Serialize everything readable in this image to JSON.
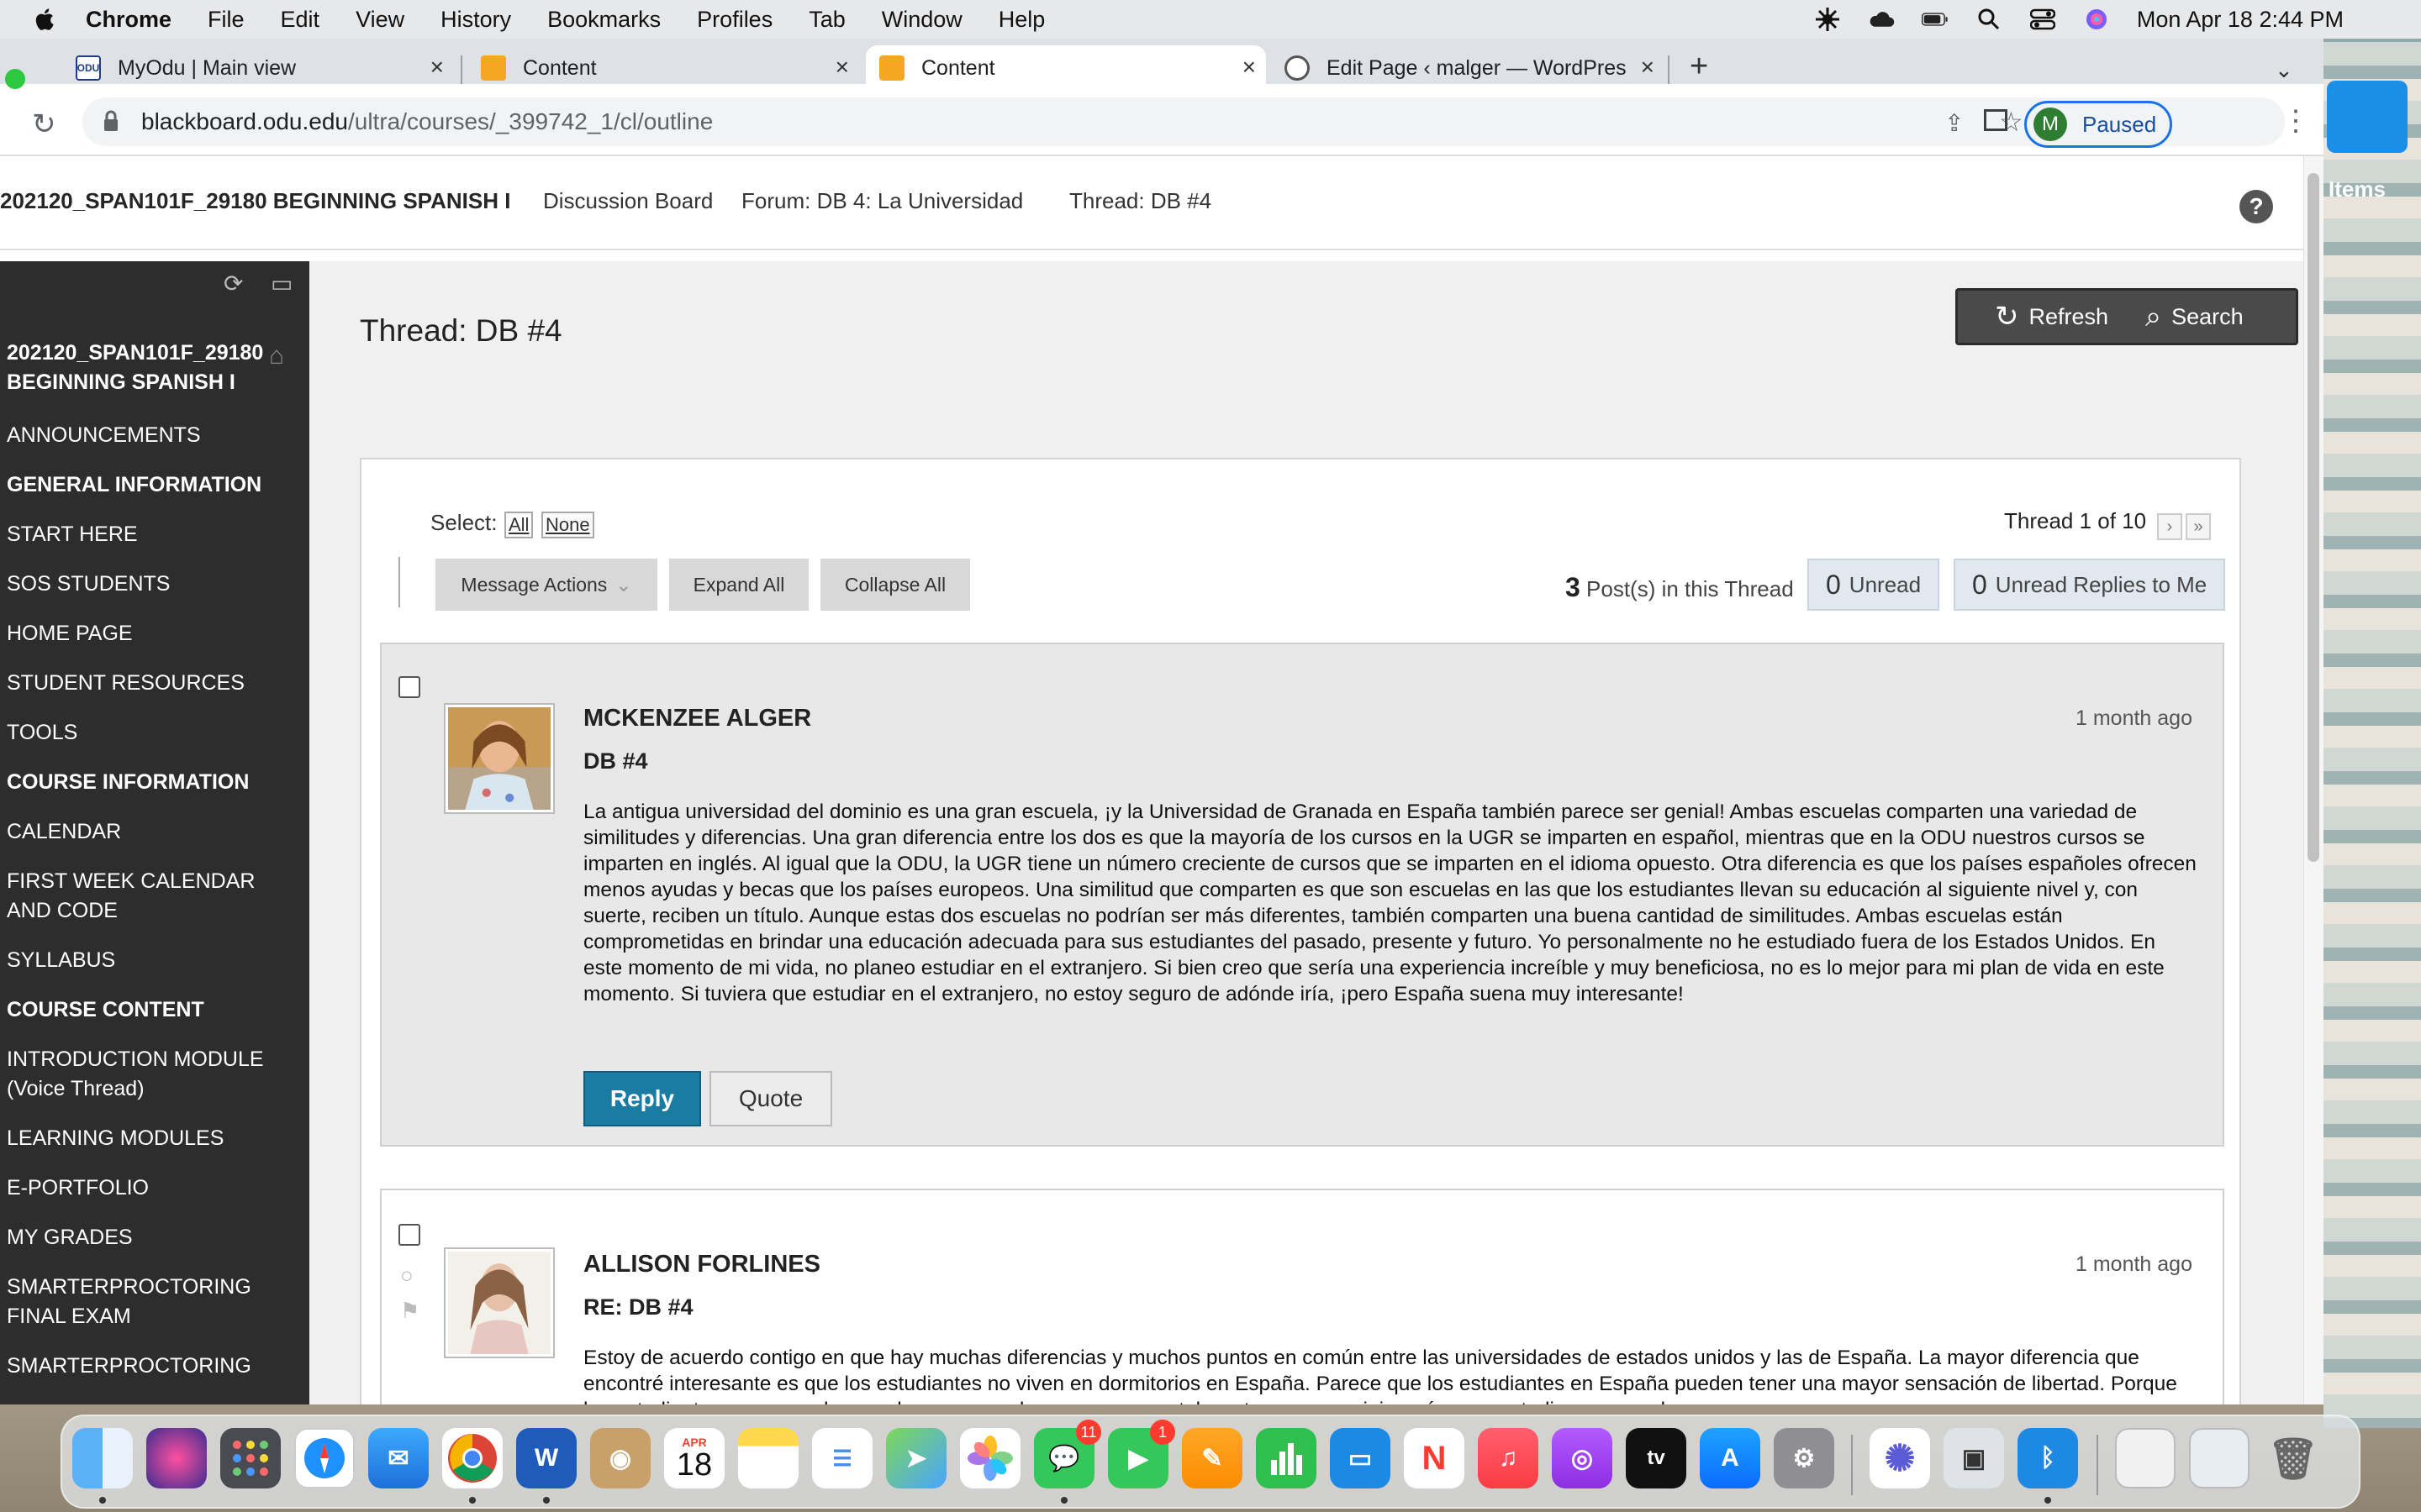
{
  "menubar": {
    "app": "Chrome",
    "items": [
      "File",
      "Edit",
      "View",
      "History",
      "Bookmarks",
      "Profiles",
      "Tab",
      "Window",
      "Help"
    ],
    "clock": "Mon Apr 18  2:44 PM"
  },
  "desktop": {
    "items_label": "Items"
  },
  "tabs": [
    {
      "title": "MyOdu | Main view"
    },
    {
      "title": "Content"
    },
    {
      "title": "Content"
    },
    {
      "title": "Edit Page ‹ malger — WordPres"
    }
  ],
  "address": {
    "host": "blackboard.odu.edu",
    "path": "/ultra/courses/_399742_1/cl/outline"
  },
  "profile": {
    "initial": "M",
    "label": "Paused"
  },
  "breadcrumb": {
    "course": "202120_SPAN101F_29180 BEGINNING SPANISH I",
    "crumbs": [
      "Discussion Board",
      "Forum: DB 4: La Universidad",
      "Thread: DB #4"
    ]
  },
  "sidebar": {
    "course_title": "202120_SPAN101F_29180 BEGINNING SPANISH I",
    "items": [
      {
        "label": "ANNOUNCEMENTS",
        "head": false
      },
      {
        "label": "GENERAL INFORMATION",
        "head": true
      },
      {
        "label": "START HERE",
        "head": false
      },
      {
        "label": "SOS STUDENTS",
        "head": false
      },
      {
        "label": "HOME PAGE",
        "head": false
      },
      {
        "label": "STUDENT RESOURCES",
        "head": false
      },
      {
        "label": "TOOLS",
        "head": false
      },
      {
        "label": "COURSE INFORMATION",
        "head": true
      },
      {
        "label": "CALENDAR",
        "head": false
      },
      {
        "label": "FIRST WEEK CALENDAR AND CODE",
        "head": false
      },
      {
        "label": "SYLLABUS",
        "head": false
      },
      {
        "label": "COURSE CONTENT",
        "head": true
      },
      {
        "label": "INTRODUCTION MODULE (Voice Thread)",
        "head": false
      },
      {
        "label": "LEARNING MODULES",
        "head": false
      },
      {
        "label": "E-PORTFOLIO",
        "head": false
      },
      {
        "label": "MY GRADES",
        "head": false
      },
      {
        "label": "SMARTERPROCTORING FINAL EXAM",
        "head": false
      },
      {
        "label": "SMARTERPROCTORING",
        "head": false
      }
    ]
  },
  "main": {
    "title": "Thread: DB #4",
    "refresh_label": "Refresh",
    "search_label": "Search",
    "select_label": "Select:",
    "select_all": "All",
    "select_none": "None",
    "message_actions": "Message Actions",
    "expand_all": "Expand All",
    "collapse_all": "Collapse All",
    "thread_position": "Thread 1 of 10",
    "post_count": "3",
    "post_count_label": "Post(s) in this Thread",
    "unread_count": "0",
    "unread_label": "Unread",
    "unread_replies_count": "0",
    "unread_replies_label": "Unread Replies to Me"
  },
  "posts": [
    {
      "author": "MCKENZEE ALGER",
      "subject": "DB #4",
      "time": "1 month ago",
      "body": "La antigua universidad del dominio es una gran escuela, ¡y la Universidad de Granada en España también parece ser genial! Ambas escuelas comparten una variedad de similitudes y diferencias. Una gran diferencia entre los dos es que la mayoría de los cursos en la UGR se imparten en español, mientras que en la ODU nuestros cursos se imparten en inglés. Al igual que la ODU, la UGR tiene un número creciente de cursos que se imparten en el idioma opuesto. Otra diferencia es que los países españoles ofrecen menos ayudas y becas que los países europeos. Una similitud que comparten es que son escuelas en las que los estudiantes llevan su educación al siguiente nivel y, con suerte, reciben un título. Aunque estas dos escuelas no podrían ser más diferentes, también comparten una buena cantidad de similitudes. Ambas escuelas están comprometidas en brindar una educación adecuada para sus estudiantes del pasado, presente y futuro. Yo personalmente no he estudiado fuera de los Estados Unidos. En este momento de mi vida, no planeo estudiar en el extranjero. Si bien creo que sería una experiencia increíble y muy beneficiosa, no es lo mejor para mi plan de vida en este momento. Si tuviera que estudiar en el extranjero, no estoy seguro de adónde iría, ¡pero España suena muy interesante!",
      "reply_label": "Reply",
      "quote_label": "Quote"
    },
    {
      "author": "ALLISON FORLINES",
      "subject": "RE: DB #4",
      "time": "1 month ago",
      "body": "Estoy de acuerdo contigo en que hay muchas diferencias y muchos puntos en común entre las universidades de estados unidos y las de España. La mayor diferencia que encontré interesante es que los estudiantes no viven en dormitorios en España. Parece que los estudiantes en España pueden tener una mayor sensación de libertad. Porque los estudiantes no se quedan en el campus me hace pensar que tal vez tengan que viajar más para estudiar, eso es algo que no"
    }
  ],
  "dock": {
    "calendar_month": "APR",
    "calendar_day": "18",
    "messages_badge": "11",
    "facetime_badge": "1",
    "tv_label": "tv"
  }
}
